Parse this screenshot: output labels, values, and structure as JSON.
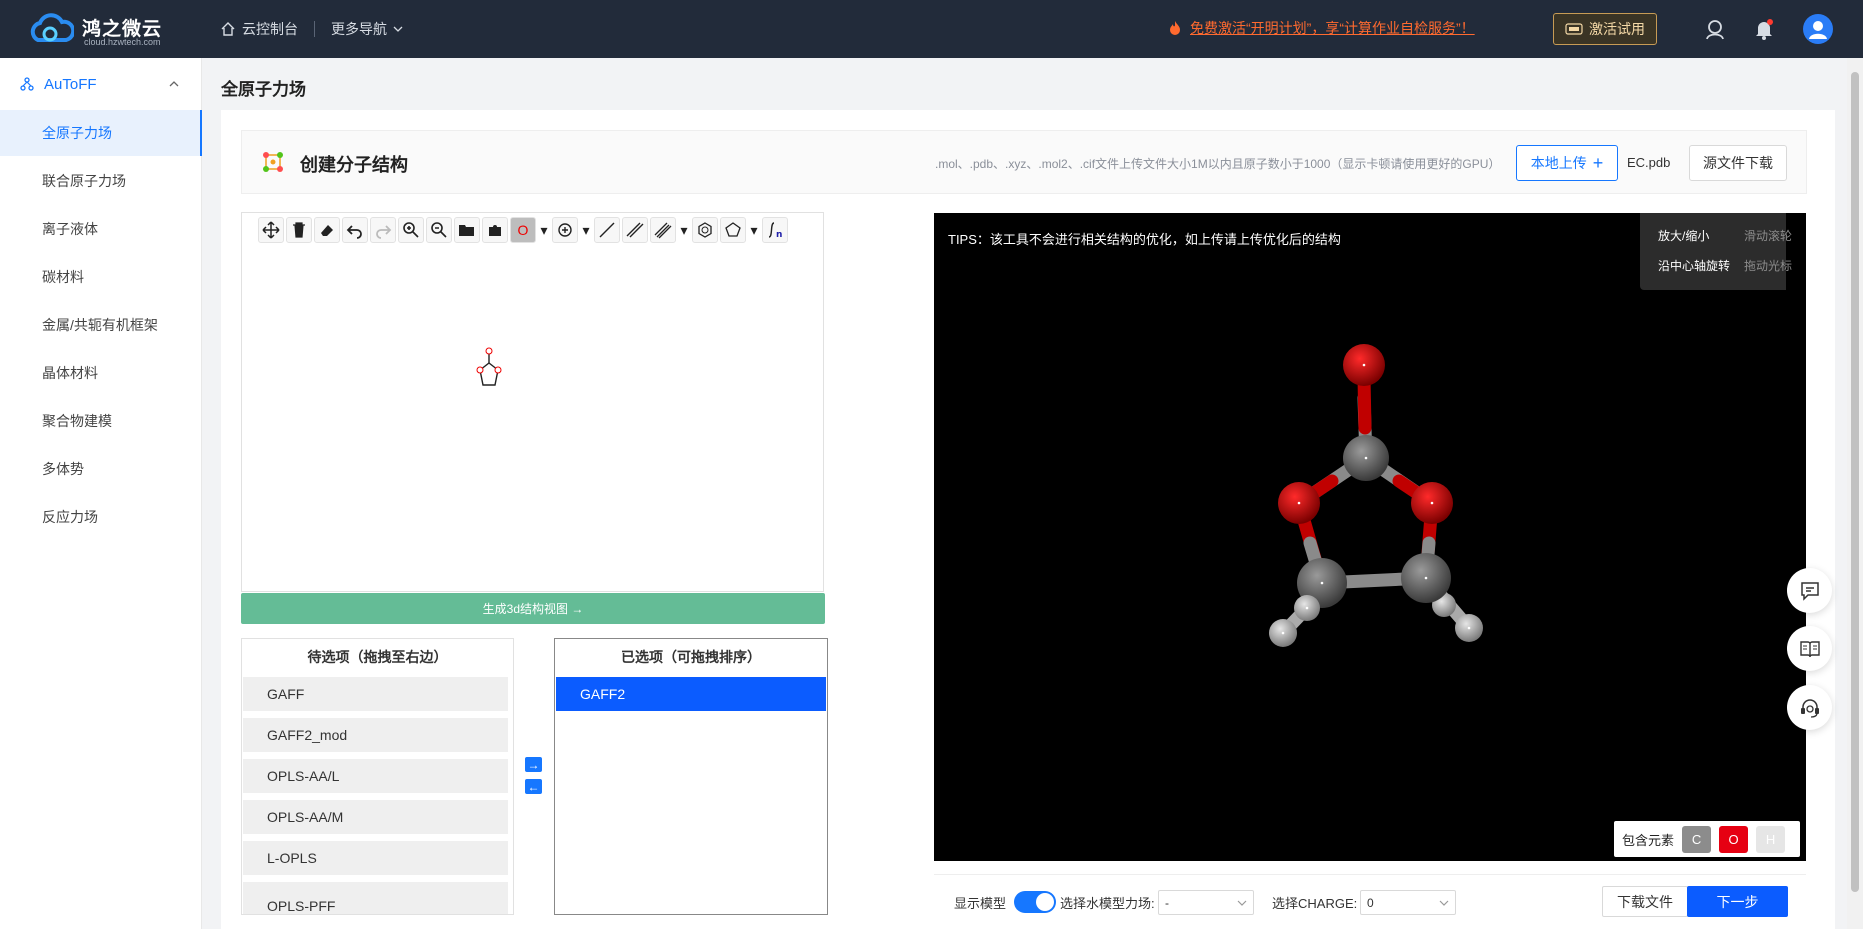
{
  "header": {
    "logo_name": "鸿之微云",
    "logo_sub": "cloud.hzwtech.com",
    "console_label": "云控制台",
    "more_nav_label": "更多导航",
    "promo_text": "免费激活“开明计划”，享“计算作业自检服务”！",
    "activate_label": "激活试用",
    "colors": {
      "bg": "#222b3a",
      "promo": "#ff6a2f"
    }
  },
  "sidebar": {
    "module": "AuToFF",
    "items": [
      {
        "label": "全原子力场",
        "active": true
      },
      {
        "label": "联合原子力场"
      },
      {
        "label": "离子液体"
      },
      {
        "label": "碳材料"
      },
      {
        "label": "金属/共轭有机框架"
      },
      {
        "label": "晶体材料"
      },
      {
        "label": "聚合物建模"
      },
      {
        "label": "多体势"
      },
      {
        "label": "反应力场"
      }
    ]
  },
  "page": {
    "title": "全原子力场",
    "create_title": "创建分子结构",
    "upload_hint": ".mol、.pdb、.xyz、.mol2、.cif文件上传文件大小1M以内且原子数小于1000（显示卡顿请使用更好的GPU）",
    "upload_label": "本地上传",
    "file_name": "EC.pdb",
    "source_download_label": "源文件下载"
  },
  "editor": {
    "atom_selected": "O",
    "generate_label": "生成3d结构视图 →"
  },
  "available": {
    "header": "待选项（拖拽至右边）",
    "items": [
      "GAFF",
      "GAFF2_mod",
      "OPLS-AA/L",
      "OPLS-AA/M",
      "L-OPLS",
      "OPLS-PFF"
    ]
  },
  "selected": {
    "header": "已选项（可拖拽排序）",
    "items": [
      "GAFF2"
    ]
  },
  "viewer": {
    "tips": "TIPS：该工具不会进行相关结构的优化，如上传请上传优化后的结构",
    "help": [
      {
        "action": "放大/缩小",
        "hint": "滑动滚轮"
      },
      {
        "action": "沿中心轴旋转",
        "hint": "拖动光标"
      }
    ],
    "elements_label": "包含元素",
    "elements": [
      {
        "symbol": "C",
        "color": "#8c8c8c"
      },
      {
        "symbol": "O",
        "color": "#e60012"
      },
      {
        "symbol": "H",
        "color": "#e6e6e6"
      }
    ]
  },
  "bottom": {
    "show_model_label": "显示模型",
    "water_model_label": "选择水模型力场:",
    "water_model_value": "-",
    "charge_label": "选择CHARGE:",
    "charge_value": "0",
    "download_label": "下载文件",
    "next_label": "下一步"
  }
}
